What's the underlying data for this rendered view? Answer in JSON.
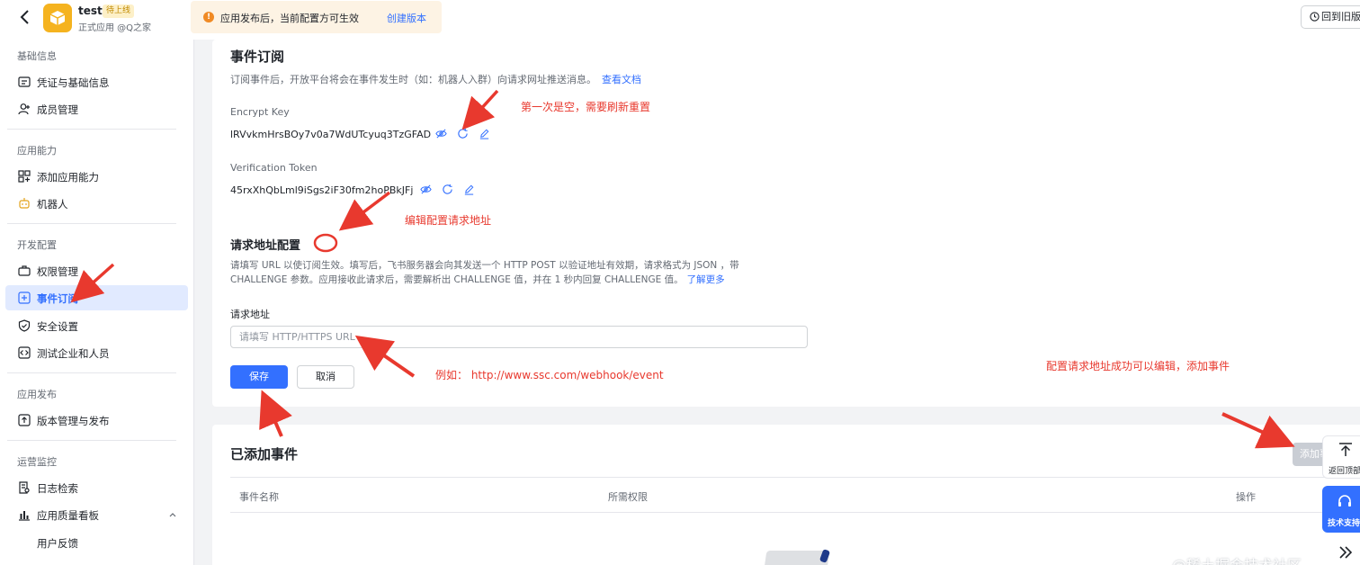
{
  "header": {
    "app_name": "test",
    "status_badge": "待上线",
    "app_subtitle": "正式应用 @Q之家",
    "notice_text": "应用发布后，当前配置方可生效",
    "notice_link": "创建版本",
    "old_version_label": "回到旧版"
  },
  "sidebar": {
    "sections": [
      {
        "title": "基础信息",
        "items": [
          "凭证与基础信息",
          "成员管理"
        ]
      },
      {
        "title": "应用能力",
        "items": [
          "添加应用能力",
          "机器人"
        ]
      },
      {
        "title": "开发配置",
        "items": [
          "权限管理",
          "事件订阅",
          "安全设置",
          "测试企业和人员"
        ]
      },
      {
        "title": "应用发布",
        "items": [
          "版本管理与发布"
        ]
      },
      {
        "title": "运营监控",
        "items": [
          "日志检索",
          "应用质量看板",
          "用户反馈"
        ]
      }
    ],
    "active_item": "事件订阅"
  },
  "event_sub": {
    "title": "事件订阅",
    "description": "订阅事件后，开放平台将会在事件发生时（如：机器人入群）向请求网址推送消息。",
    "doc_link": "查看文档",
    "encrypt_key_label": "Encrypt Key",
    "encrypt_key_value": "lRVvkmHrsBOy7v0a7WdUTcyuq3TzGFAD",
    "verification_token_label": "Verification Token",
    "verification_token_value": "45rxXhQbLml9iSgs2iF30fm2hoPBkJFj"
  },
  "request_config": {
    "title": "请求地址配置",
    "description": "请填写 URL 以使订阅生效。填写后，飞书服务器会向其发送一个 HTTP POST 以验证地址有效期，请求格式为 JSON ，带 CHALLENGE 参数。应用接收此请求后，需要解析出 CHALLENGE 值，并在 1 秒内回复 CHALLENGE 值。",
    "learn_more": "了解更多",
    "field_label": "请求地址",
    "placeholder": "请填写 HTTP/HTTPS URL",
    "save_label": "保存",
    "cancel_label": "取消"
  },
  "added_events": {
    "title": "已添加事件",
    "add_button": "添加事件",
    "columns": [
      "事件名称",
      "所需权限",
      "操作"
    ]
  },
  "float": {
    "back_to_top": "返回顶部",
    "support": "技术支持"
  },
  "annotations": {
    "first_empty": "第一次是空，需要刷新重置",
    "edit_url": "编辑配置请求地址",
    "example": "例如：   http://www.ssc.com/webhook/event",
    "after_config": "配置请求地址成功可以编辑，添加事件"
  },
  "watermark": "@稀土掘金技术社区",
  "colors": {
    "primary": "#3370ff",
    "annotation": "#e8392e",
    "app_icon": "#f5b31f"
  }
}
